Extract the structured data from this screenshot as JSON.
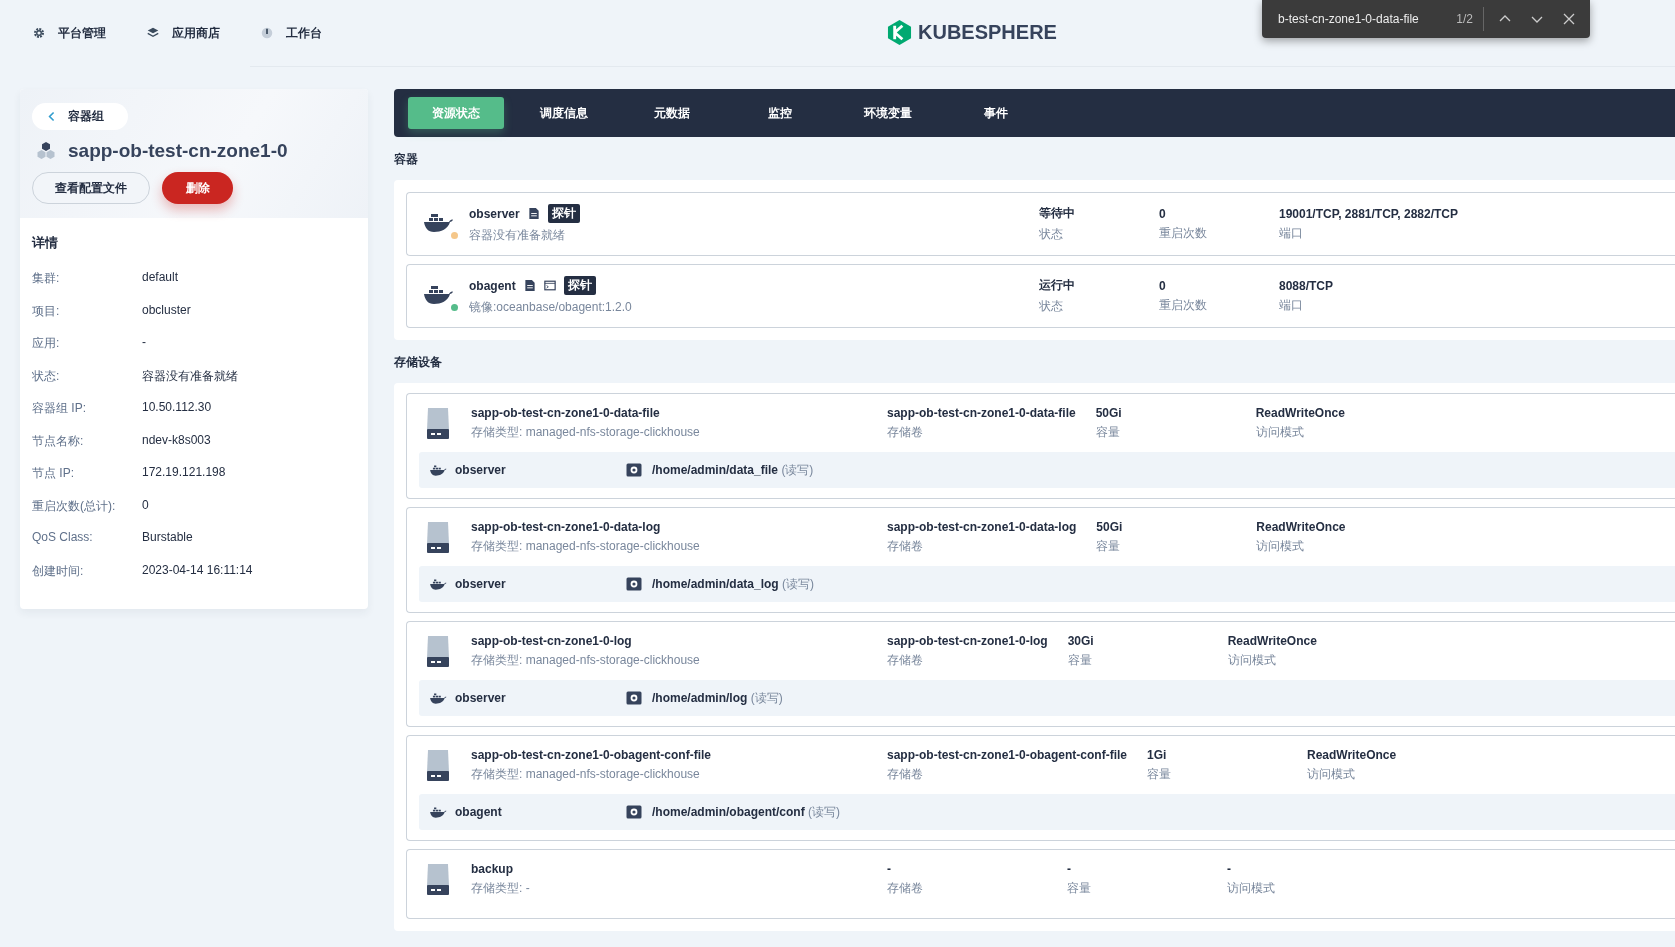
{
  "nav": [
    {
      "label": "平台管理",
      "kind": "gear"
    },
    {
      "label": "应用商店",
      "kind": "layers"
    },
    {
      "label": "工作台",
      "kind": "desk"
    }
  ],
  "logo": {
    "text": "KUBESPHERE"
  },
  "find_bar": {
    "query": "b-test-cn-zone1-0-data-file",
    "count": "1/2"
  },
  "pod": {
    "back": "容器组",
    "name": "sapp-ob-test-cn-zone1-0",
    "buttons": [
      {
        "label": "查看配置文件",
        "kind": "default"
      },
      {
        "label": "删除",
        "kind": "danger"
      }
    ],
    "details_title": "详情",
    "details": [
      {
        "label": "集群:",
        "value": "default"
      },
      {
        "label": "项目:",
        "value": "obcluster"
      },
      {
        "label": "应用:",
        "value": "-"
      },
      {
        "label": "状态:",
        "value": "容器没有准备就绪"
      },
      {
        "label": "容器组 IP:",
        "value": "10.50.112.30"
      },
      {
        "label": "节点名称:",
        "value": "ndev-k8s003"
      },
      {
        "label": "节点 IP:",
        "value": "172.19.121.198"
      },
      {
        "label": "重启次数(总计):",
        "value": "0"
      },
      {
        "label": "QoS Class:",
        "value": "Burstable"
      },
      {
        "label": "创建时间:",
        "value": "2023-04-14 16:11:14"
      }
    ]
  },
  "tabs": [
    {
      "label": "资源状态",
      "selected": true
    },
    {
      "label": "调度信息",
      "selected": false
    },
    {
      "label": "元数据",
      "selected": false
    },
    {
      "label": "监控",
      "selected": false
    },
    {
      "label": "环境变量",
      "selected": false
    },
    {
      "label": "事件",
      "selected": false
    }
  ],
  "containers_title": "容器",
  "containers": [
    {
      "name": "observer",
      "terminal": false,
      "probe": "探针",
      "sub": "容器没有准备就绪",
      "color": "#f5c78a",
      "status": "等待中",
      "status_label": "状态",
      "restarts": "0",
      "restarts_label": "重启次数",
      "ports": "19001/TCP, 2881/TCP, 2882/TCP",
      "ports_label": "端口"
    },
    {
      "name": "obagent",
      "terminal": true,
      "probe": "探针",
      "sub": "镜像:oceanbase/obagent:1.2.0",
      "color": "#55bc8a",
      "status": "运行中",
      "status_label": "状态",
      "restarts": "0",
      "restarts_label": "重启次数",
      "ports": "8088/TCP",
      "ports_label": "端口"
    }
  ],
  "storage_title": "存储设备",
  "volumes": [
    {
      "name": "sapp-ob-test-cn-zone1-0-data-file",
      "type_label": "存储类型:",
      "type": "managed-nfs-storage-clickhouse",
      "volume": "sapp-ob-test-cn-zone1-0-data-file",
      "volume_label": "存储卷",
      "capacity": "50Gi",
      "capacity_label": "容量",
      "mode": "ReadWriteOnce",
      "mode_label": "访问模式",
      "mount": {
        "container": "observer",
        "path": "/home/admin/data_file",
        "access": "(读写)"
      }
    },
    {
      "name": "sapp-ob-test-cn-zone1-0-data-log",
      "type_label": "存储类型:",
      "type": "managed-nfs-storage-clickhouse",
      "volume": "sapp-ob-test-cn-zone1-0-data-log",
      "volume_label": "存储卷",
      "capacity": "50Gi",
      "capacity_label": "容量",
      "mode": "ReadWriteOnce",
      "mode_label": "访问模式",
      "mount": {
        "container": "observer",
        "path": "/home/admin/data_log",
        "access": "(读写)"
      }
    },
    {
      "name": "sapp-ob-test-cn-zone1-0-log",
      "type_label": "存储类型:",
      "type": "managed-nfs-storage-clickhouse",
      "volume": "sapp-ob-test-cn-zone1-0-log",
      "volume_label": "存储卷",
      "capacity": "30Gi",
      "capacity_label": "容量",
      "mode": "ReadWriteOnce",
      "mode_label": "访问模式",
      "mount": {
        "container": "observer",
        "path": "/home/admin/log",
        "access": "(读写)"
      }
    },
    {
      "name": "sapp-ob-test-cn-zone1-0-obagent-conf-file",
      "type_label": "存储类型:",
      "type": "managed-nfs-storage-clickhouse",
      "volume": "sapp-ob-test-cn-zone1-0-obagent-conf-file",
      "volume_label": "存储卷",
      "capacity": "1Gi",
      "capacity_label": "容量",
      "mode": "ReadWriteOnce",
      "mode_label": "访问模式",
      "mount": {
        "container": "obagent",
        "path": "/home/admin/obagent/conf",
        "access": "(读写)"
      }
    },
    {
      "name": "backup",
      "type_label": "存储类型:",
      "type": "-",
      "volume": "-",
      "volume_label": "存储卷",
      "capacity": "-",
      "capacity_label": "容量",
      "mode": "-",
      "mode_label": "访问模式"
    }
  ]
}
